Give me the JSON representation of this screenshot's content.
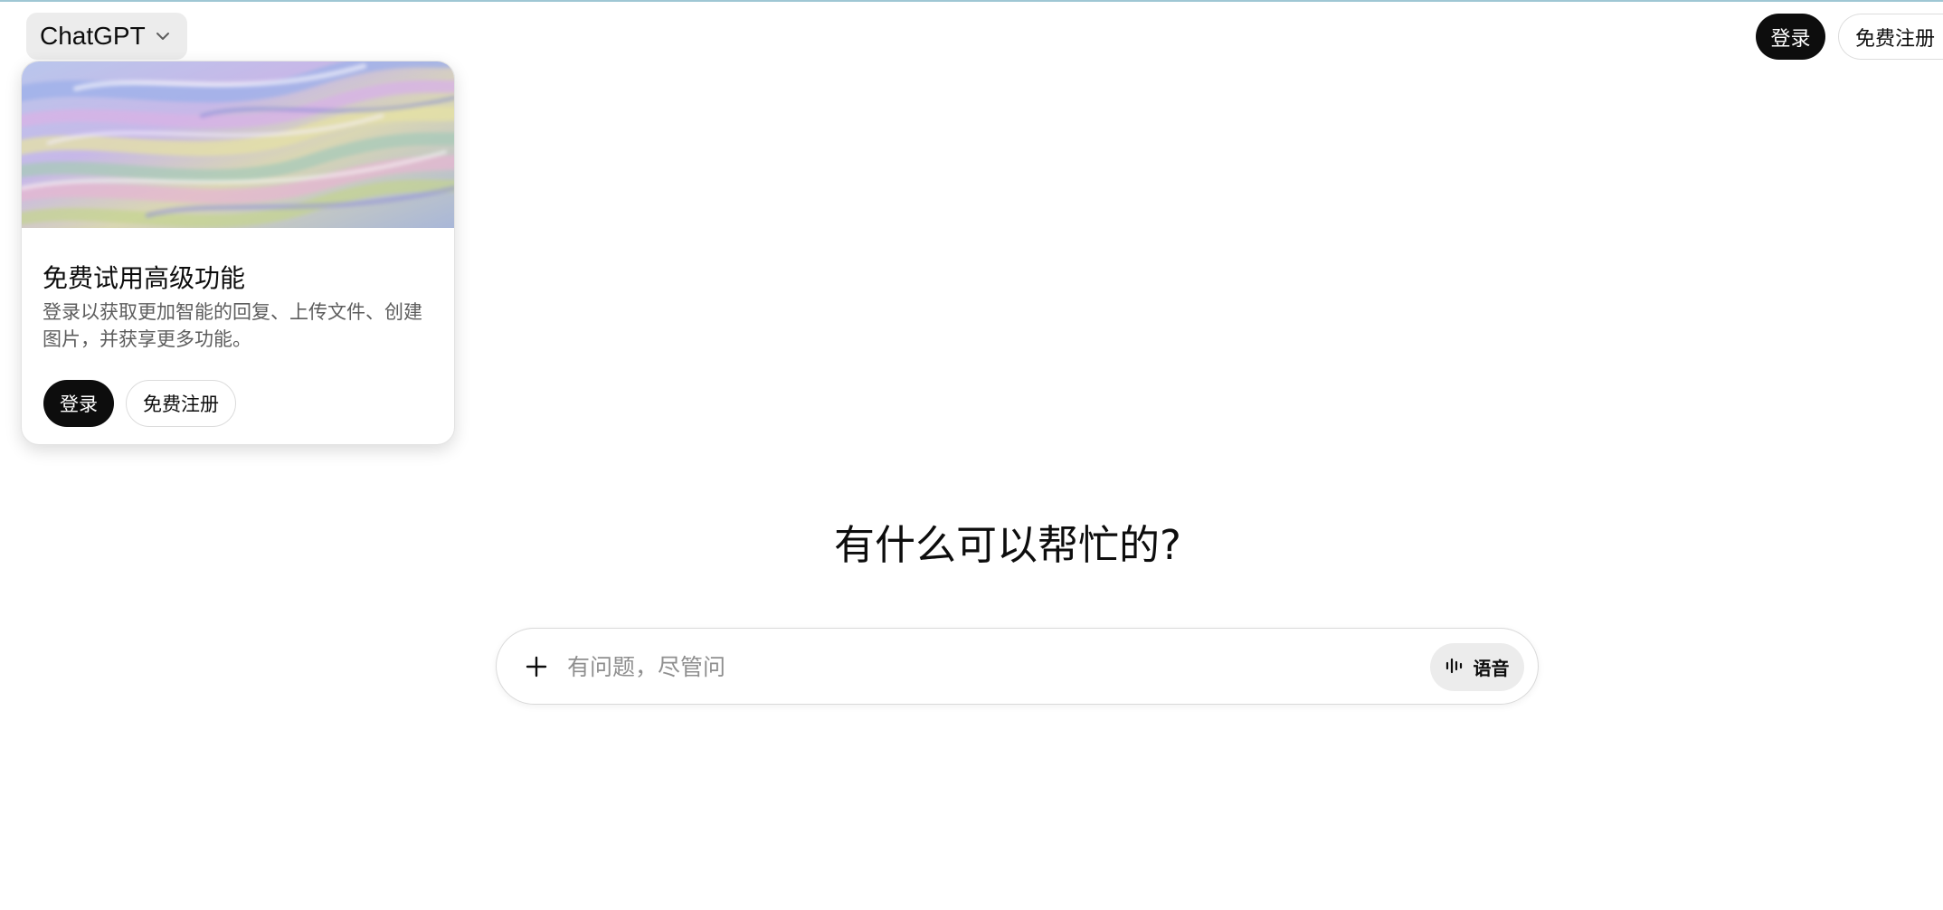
{
  "header": {
    "model_name": "ChatGPT",
    "login_label": "登录",
    "signup_label": "免费注册"
  },
  "promo_card": {
    "title": "免费试用高级功能",
    "description": "登录以获取更加智能的回复、上传文件、创建图片，并获享更多功能。",
    "login_label": "登录",
    "signup_label": "免费注册"
  },
  "main": {
    "headline": "有什么可以帮忙的?",
    "composer": {
      "placeholder": "有问题，尽管问",
      "value": "",
      "voice_label": "语音"
    }
  },
  "icons": {
    "model_dropdown": "chevron-down-icon",
    "attach": "plus-icon",
    "voice": "waveform-icon"
  },
  "colors": {
    "primary_button": "#0d0d0d",
    "secondary_button_border": "#dcdcdc",
    "composer_voice_bg": "#ececec",
    "top_accent": "#9fc7d4"
  }
}
